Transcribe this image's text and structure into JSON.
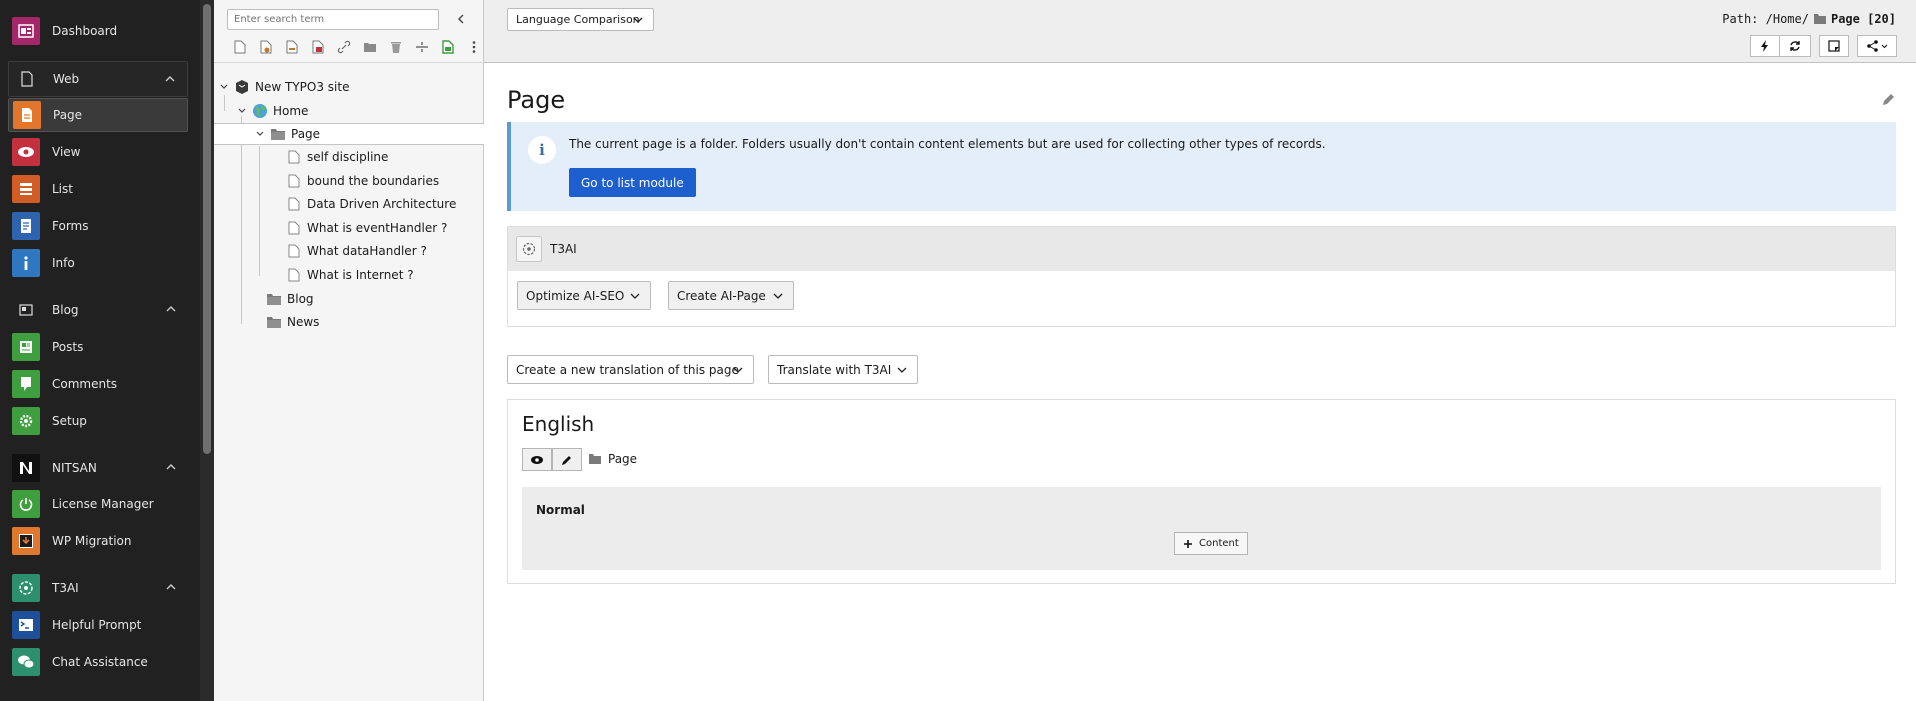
{
  "module_menu": {
    "dashboard": "Dashboard",
    "groups": [
      {
        "label": "Web",
        "items": [
          "Page",
          "View",
          "List",
          "Forms",
          "Info"
        ]
      },
      {
        "label": "Blog",
        "items": [
          "Posts",
          "Comments",
          "Setup"
        ]
      },
      {
        "label": "NITSAN",
        "items": [
          "License Manager",
          "WP Migration"
        ]
      },
      {
        "label": "T3AI",
        "items": [
          "Helpful Prompt",
          "Chat Assistance"
        ]
      }
    ]
  },
  "tree": {
    "search_placeholder": "Enter search term",
    "root": "New TYPO3 site",
    "home": "Home",
    "page": "Page",
    "children": [
      "self discipline",
      "bound the boundaries",
      "Data Driven Architecture",
      "What is eventHandler ?",
      "What dataHandler ?",
      "What is Internet ?"
    ],
    "blog": "Blog",
    "news": "News"
  },
  "header": {
    "language_select": "Language Comparison",
    "path_label": "Path: /Home/",
    "path_page": "Page [20]"
  },
  "main": {
    "title": "Page",
    "info_text": "The current page is a folder. Folders usually don't contain content elements but are used for collecting other types of records.",
    "info_button": "Go to list module",
    "t3ai_title": "T3AI",
    "optimize_select": "Optimize AI-SEO",
    "create_select": "Create AI-Page",
    "translation_select": "Create a new translation of this page",
    "translate_select": "Translate with T3AI",
    "language_title": "English",
    "page_ref": "Page",
    "column_name": "Normal",
    "add_content": "Content"
  },
  "colors": {
    "accent_blue": "#1d5fcd",
    "menu_bg": "#212121",
    "dashboard": "#a4276a",
    "page": "#e2772b",
    "view": "#c3303e",
    "list": "#d25c25",
    "forms": "#2d64ad",
    "info": "#2f77c0",
    "blog_green": "#3f9f3f",
    "license": "#3f9f3f",
    "wp_migration": "#e07830",
    "t3ai_teal": "#2e8f6e",
    "helpful_prompt": "#1e4f9a",
    "chat": "#2e8f6e"
  },
  "icons": [
    "dashboard-icon",
    "page-icon",
    "eye-icon",
    "list-icon",
    "forms-icon",
    "info-icon",
    "blog-icon",
    "posts-icon",
    "comments-icon",
    "setup-icon",
    "nitsan-logo-icon",
    "power-icon",
    "download-icon",
    "t3ai-icon",
    "terminal-icon",
    "chat-icon"
  ]
}
